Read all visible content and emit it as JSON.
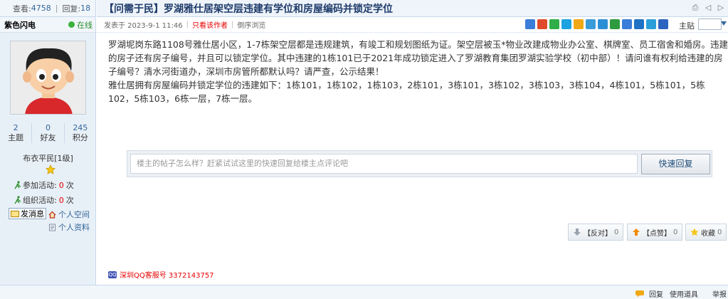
{
  "stats": {
    "views_label": "查看:",
    "views": "4758",
    "replies_label": "回复:",
    "replies": "18"
  },
  "author": {
    "name": "紫色闪电",
    "online_label": "在线",
    "counts": [
      {
        "value": "2",
        "label": "主题"
      },
      {
        "value": "0",
        "label": "好友"
      },
      {
        "value": "245",
        "label": "积分"
      }
    ],
    "rank": "布衣平民[1级]",
    "activity1_label": "参加活动:",
    "activity1_count": "0",
    "activity1_unit": "次",
    "activity2_label": "组织活动:",
    "activity2_count": "0",
    "activity2_unit": "次",
    "send_msg": "发消息",
    "space_link": "个人空间",
    "profile_link": "个人资料"
  },
  "post": {
    "title": "【问需于民】罗湖雅仕居架空层违建有学位和房屋编码并锁定学位",
    "posted_at": "发表于 2023-9-1 11:46",
    "only_author": "只看该作者",
    "reverse_view": "倒序浏览",
    "floor_label": "主贴",
    "paragraphs": [
      "罗湖坭岗东路1108号雅仕居小区，1-7栋架空层都是违规建筑，有竣工和规划图纸为证。架空层被玉*物业改建成物业办公室、棋牌室、员工宿舍和婚房。违建的房子还有房子编号，并且可以锁定学位。其中违建的1栋101已于2021年成功锁定进入了罗湖教育集团罗湖实验学校（初中部）！请问谁有权利给违建的房子编号？清水河街道办，深圳市房管所都默认吗？请严查，公示结果！",
      "雅仕居拥有房屋编码并锁定学位的违建如下：1栋101，1栋102，1栋103，2栋101，3栋101，3栋102，3栋103，3栋104，4栋101，5栋101，5栋102，5栋103，6栋一层，7栋一层。"
    ]
  },
  "quick_reply": {
    "placeholder": "楼主的帖子怎么样？赶紧试试这里的快速回复给楼主点评论吧",
    "button": "快速回复"
  },
  "votes": {
    "against_label": "【反对】",
    "against_count": "0",
    "support_label": "【点赞】",
    "support_count": "0",
    "favorite_label": "收藏",
    "favorite_count": "0"
  },
  "qq_service": "深圳QQ客服号 3372143757",
  "bottom": {
    "reply": "回复",
    "tools": "使用道具",
    "report": "举报"
  },
  "colors": {
    "accent": "#336699",
    "highlight": "#e60000",
    "panel": "#e8f0f7"
  }
}
